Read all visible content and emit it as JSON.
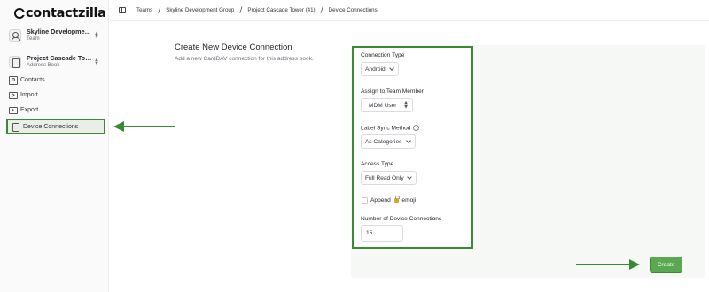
{
  "app": {
    "brand": "contactzilla"
  },
  "sidebar": {
    "team": {
      "title": "Skyline Developmen...",
      "subtitle": "Team"
    },
    "book": {
      "title": "Project Cascade Tow...",
      "subtitle": "Address Book"
    },
    "items": [
      {
        "label": "Contacts",
        "icon": "contacts-icon"
      },
      {
        "label": "Import",
        "icon": "import-icon"
      },
      {
        "label": "Export",
        "icon": "export-icon"
      },
      {
        "label": "Device Connections",
        "icon": "device-icon",
        "active": true
      }
    ]
  },
  "breadcrumb": [
    "Teams",
    "Skyline Development Group",
    "Project Cascade Tower (41)",
    "Device Connections"
  ],
  "page": {
    "title": "Create New Device Connection",
    "description": "Add a new CardDAV connection for this address book."
  },
  "form": {
    "connection_type": {
      "label": "Connection Type",
      "value": "Android"
    },
    "team_member": {
      "label": "Assign to Team Member",
      "value": "MDM User"
    },
    "label_sync": {
      "label": "Label Sync Method",
      "value": "As Categories"
    },
    "access_type": {
      "label": "Access Type",
      "value": "Full Read Only"
    },
    "append_emoji": {
      "label_before": "Append",
      "label_after": "emoji",
      "checked": false
    },
    "device_connections": {
      "label": "Number of Device Connections",
      "value": "15"
    },
    "submit_label": "Create"
  },
  "colors": {
    "accent": "#3a8a35",
    "button": "#5aa84f"
  }
}
